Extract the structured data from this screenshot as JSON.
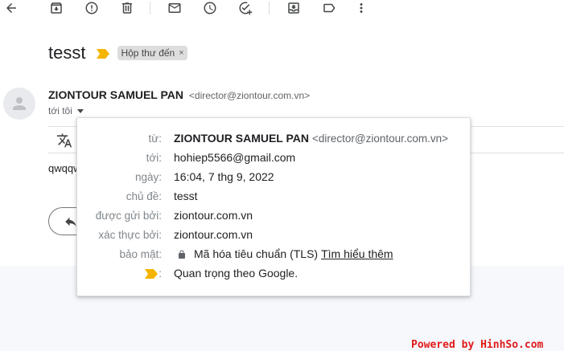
{
  "toolbar": {
    "icons": [
      "back-arrow-icon",
      "archive-icon",
      "report-spam-icon",
      "delete-icon",
      "mark-unread-icon",
      "snooze-icon",
      "add-to-tasks-icon",
      "move-to-icon",
      "labels-icon",
      "more-vert-icon"
    ]
  },
  "email": {
    "subject": "tesst",
    "label_chip": "Hộp thư đến",
    "label_remove": "×",
    "sender_name": "ZIONTOUR SAMUEL PAN",
    "sender_email": "<director@ziontour.com.vn>",
    "to_line": "tới tôi",
    "body_preview": "qwqqw"
  },
  "details_popup": {
    "rows": [
      {
        "label": "từ:",
        "name": "ZIONTOUR SAMUEL PAN",
        "value": "<director@ziontour.com.vn>"
      },
      {
        "label": "tới:",
        "value": "hohiep5566@gmail.com"
      },
      {
        "label": "ngày:",
        "value": "16:04, 7 thg 9, 2022"
      },
      {
        "label": "chủ đề:",
        "value": "tesst"
      },
      {
        "label": "được gửi bởi:",
        "value": "ziontour.com.vn"
      },
      {
        "label": "xác thực bởi:",
        "value": "ziontour.com.vn"
      },
      {
        "label": "bảo mật:",
        "value": "Mã hóa tiêu chuẩn (TLS)",
        "link": "Tìm hiểu thêm"
      },
      {
        "label": ":",
        "value": "Quan trọng theo Google."
      }
    ]
  },
  "colors": {
    "importance_marker": "#f4b400",
    "watermark": "#e01a1a"
  },
  "watermark": "Powered by HinhSo.com"
}
